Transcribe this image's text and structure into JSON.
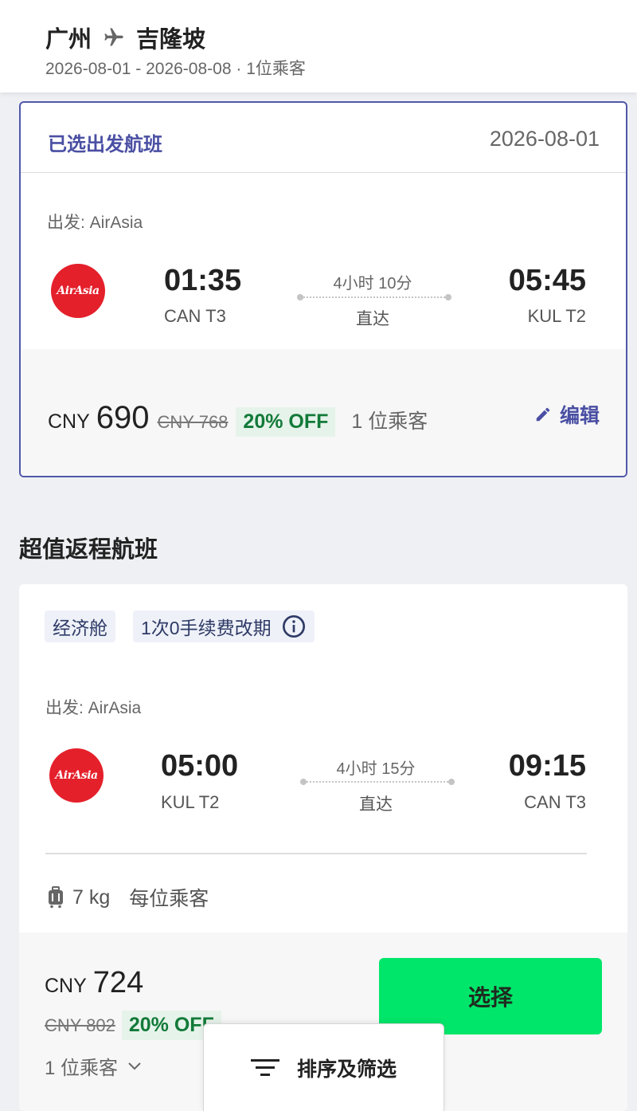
{
  "header": {
    "origin": "广州",
    "destination": "吉隆坡",
    "dates": "2026-08-01 - 2026-08-08",
    "separator": " · ",
    "passengers": "1位乘客"
  },
  "selected_flight": {
    "title": "已选出发航班",
    "date": "2026-08-01",
    "depart_label": "出发: AirAsia",
    "airline_logo_text": "AirAsia",
    "depart_time": "01:35",
    "depart_airport": "CAN T3",
    "duration": "4小时 10分",
    "stops": "直达",
    "arrive_time": "05:45",
    "arrive_airport": "KUL T2",
    "currency": "CNY",
    "price": "690",
    "original_price": "CNY 768",
    "discount": "20% OFF",
    "passengers": "1 位乘客",
    "edit_label": "编辑"
  },
  "section_title": "超值返程航班",
  "return_flight": {
    "tags": [
      "经济舱",
      "1次0手续费改期"
    ],
    "depart_label": "出发: AirAsia",
    "airline_logo_text": "AirAsia",
    "depart_time": "05:00",
    "depart_airport": "KUL T2",
    "duration": "4小时 15分",
    "stops": "直达",
    "arrive_time": "09:15",
    "arrive_airport": "CAN T3",
    "baggage": "7 kg",
    "baggage_note": "每位乘客",
    "currency": "CNY",
    "price": "724",
    "original_price": "CNY 802",
    "discount": "20% OFF",
    "passengers": "1 位乘客",
    "select_label": "选择"
  },
  "filter_label": "排序及筛选",
  "colors": {
    "accent": "#4a4fa3",
    "select_button": "#00e66a",
    "discount_text": "#127a39",
    "airasia_red": "#e4202b"
  }
}
